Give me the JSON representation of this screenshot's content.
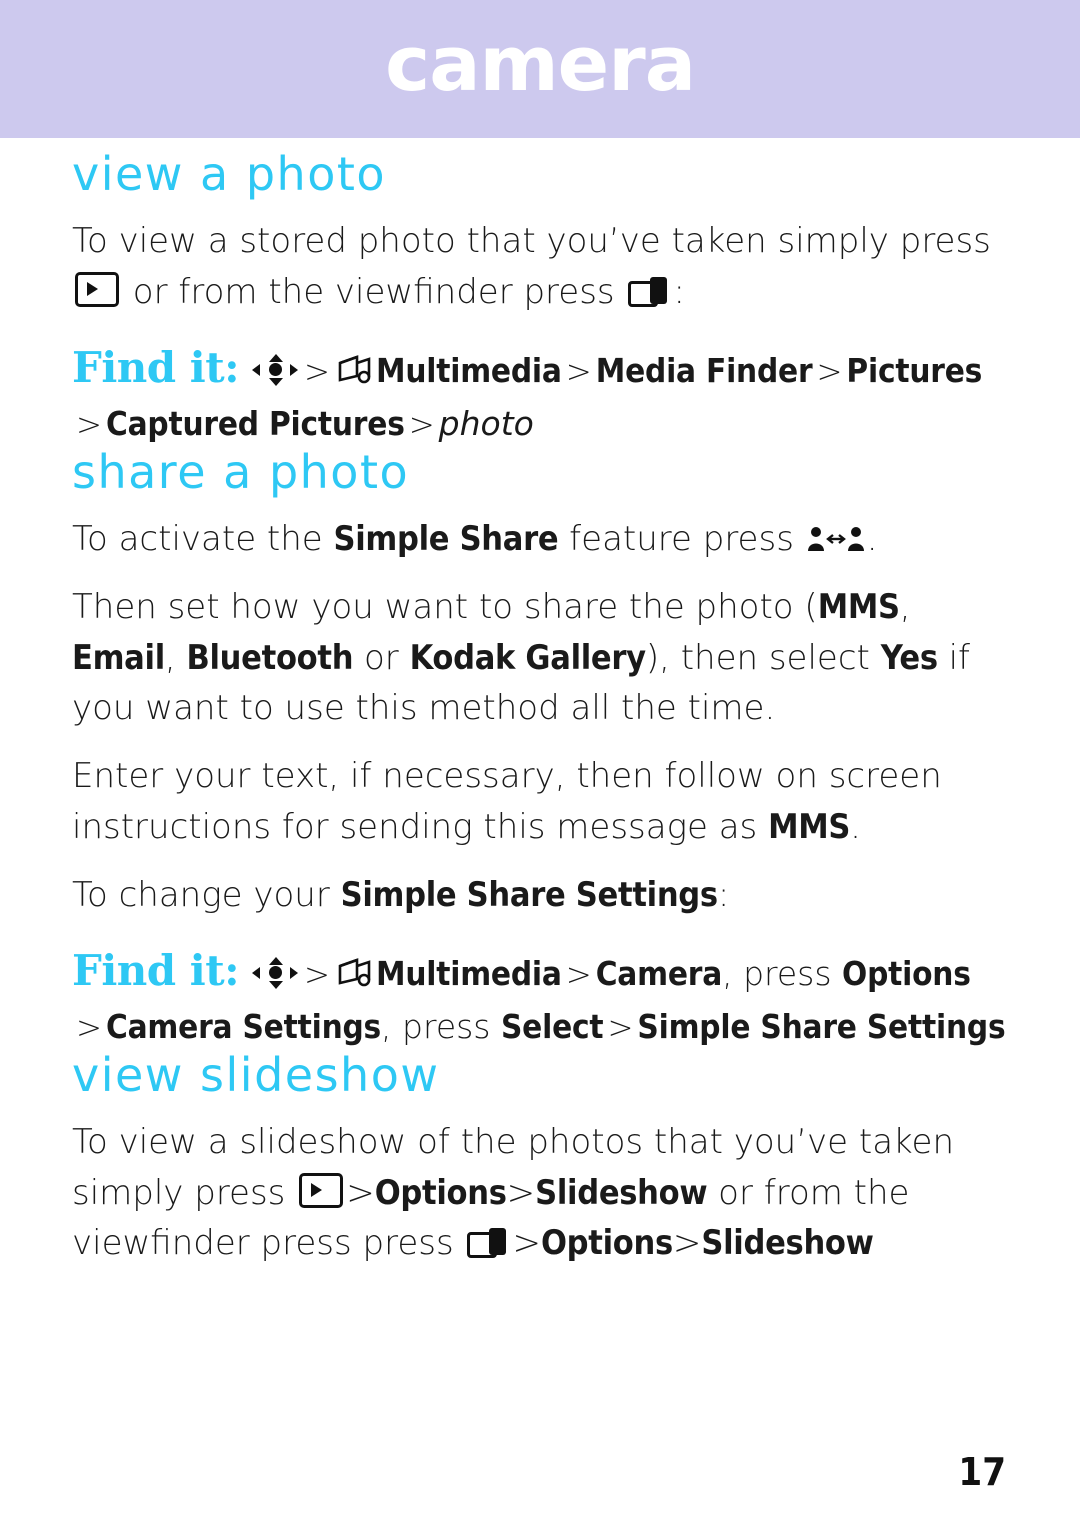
{
  "header": {
    "title": "camera",
    "band_color": "#cdc9ee",
    "title_color": "#ffffff"
  },
  "accent_color": "#2ec8f4",
  "sections": [
    {
      "heading": "view a photo",
      "paragraphs": [
        {
          "parts": [
            {
              "text": "To view a stored photo that you’ve taken simply press "
            },
            {
              "icon": "photo-key-icon"
            },
            {
              "text": " or from the viewfinder press "
            },
            {
              "icon": "camera-key-icon"
            },
            {
              "text": ":"
            }
          ]
        }
      ],
      "find_it": {
        "label": "Find it:",
        "line1": [
          {
            "icon": "navigation-key-icon"
          },
          {
            "sep": ">"
          },
          {
            "icon": "multimedia-icon"
          },
          {
            "bold": "Multimedia"
          },
          {
            "sep": ">"
          },
          {
            "bold": "Media Finder"
          },
          {
            "sep": ">"
          },
          {
            "bold": "Pictures"
          }
        ],
        "line2": [
          {
            "sep": ">"
          },
          {
            "bold": "Captured Pictures"
          },
          {
            "sep": ">"
          },
          {
            "italic": "photo"
          }
        ]
      }
    },
    {
      "heading": "share a photo",
      "paragraphs": [
        {
          "parts": [
            {
              "text": "To activate the "
            },
            {
              "bold": "Simple Share"
            },
            {
              "text": " feature press "
            },
            {
              "icon": "simple-share-icon"
            },
            {
              "text": "."
            }
          ]
        },
        {
          "parts": [
            {
              "text": "Then set how you want to share the photo ("
            },
            {
              "bold": "MMS"
            },
            {
              "text": ", "
            },
            {
              "bold": "Email"
            },
            {
              "text": ", "
            },
            {
              "bold": "Bluetooth"
            },
            {
              "text": " or "
            },
            {
              "bold": "Kodak Gallery"
            },
            {
              "text": "), then select "
            },
            {
              "bold": "Yes"
            },
            {
              "text": " if you want to use this method all the time."
            }
          ]
        },
        {
          "parts": [
            {
              "text": "Enter your text, if necessary, then follow on screen instructions for sending this message as "
            },
            {
              "bold": "MMS"
            },
            {
              "text": "."
            }
          ]
        },
        {
          "parts": [
            {
              "text": "To change your "
            },
            {
              "bold": "Simple Share Settings"
            },
            {
              "text": ":"
            }
          ]
        }
      ],
      "find_it": {
        "label": "Find it:",
        "line1": [
          {
            "icon": "navigation-key-icon"
          },
          {
            "sep": ">"
          },
          {
            "icon": "multimedia-icon"
          },
          {
            "bold": "Multimedia"
          },
          {
            "sep": ">"
          },
          {
            "bold": "Camera"
          },
          {
            "text": ", press "
          },
          {
            "bold": "Options"
          }
        ],
        "line2": [
          {
            "sep": ">"
          },
          {
            "bold": "Camera Settings"
          },
          {
            "text": ", press "
          },
          {
            "bold": "Select"
          },
          {
            "sep": ">"
          },
          {
            "bold": "Simple Share Settings"
          }
        ]
      }
    },
    {
      "heading": "view slideshow",
      "paragraphs": [
        {
          "parts": [
            {
              "text": "To view a slideshow of the photos that you’ve taken simply press "
            },
            {
              "icon": "photo-key-icon"
            },
            {
              "sep": ">"
            },
            {
              "bold": "Options"
            },
            {
              "sep": ">"
            },
            {
              "bold": "Slideshow"
            },
            {
              "text": " or from the viewfinder press "
            },
            {
              "icon": "camera-key-icon"
            },
            {
              "sep": ">"
            },
            {
              "bold": "Options"
            },
            {
              "sep": ">"
            },
            {
              "bold": "Slideshow"
            }
          ]
        }
      ]
    }
  ],
  "footer": {
    "page_number": "17"
  },
  "text": {
    "p1_a": "To view a stored photo that you’ve taken simply press ",
    "p1_b": " or from the viewfinder press ",
    "p1_c": ":",
    "findit_label": "Find it:",
    "f1_multimedia": "Multimedia",
    "f1_mediafinder": "Media Finder",
    "f1_pictures": "Pictures",
    "f1_captured": "Captured Pictures",
    "f1_photo": "photo",
    "p2_a": "To activate the ",
    "p2_simpleshare": "Simple Share",
    "p2_b": " feature press ",
    "p2_c": ".",
    "p3_a": "Then set how you want to share the photo (",
    "p3_mms": "MMS",
    "p3_comma1": ", ",
    "p3_email": "Email",
    "p3_comma2": ", ",
    "p3_bluetooth": "Bluetooth",
    "p3_or": " or ",
    "p3_kodak": "Kodak Gallery",
    "p3_then": "), then select ",
    "p3_yes": "Yes",
    "p3_tail": " if you want to use this method all the time.",
    "p4_a": "Enter your text, if necessary, then follow on screen instructions for sending this message as ",
    "p4_mms": "MMS",
    "p4_c": ".",
    "p5_a": "To change your ",
    "p5_settings": "Simple Share Settings",
    "p5_c": ":",
    "f2_multimedia": "Multimedia",
    "f2_camera": "Camera",
    "f2_press": ", press ",
    "f2_options": "Options",
    "f2_camerasettings": "Camera Settings",
    "f2_press2": ", press ",
    "f2_select": "Select",
    "f2_simplesharesettings": "Simple Share Settings",
    "p6_a": "To view a slideshow of the photos that you’ve taken simply press ",
    "p6_options1": "Options",
    "p6_slideshow1": "Slideshow",
    "p6_b": " or from the viewfinder press ",
    "p6_press": "press ",
    "p6_options2": "Options",
    "p6_slideshow2": "Slideshow",
    "gt": ">"
  },
  "headings": {
    "view_photo": "view a photo",
    "share_photo": "share a photo",
    "view_slideshow": "view slideshow"
  }
}
